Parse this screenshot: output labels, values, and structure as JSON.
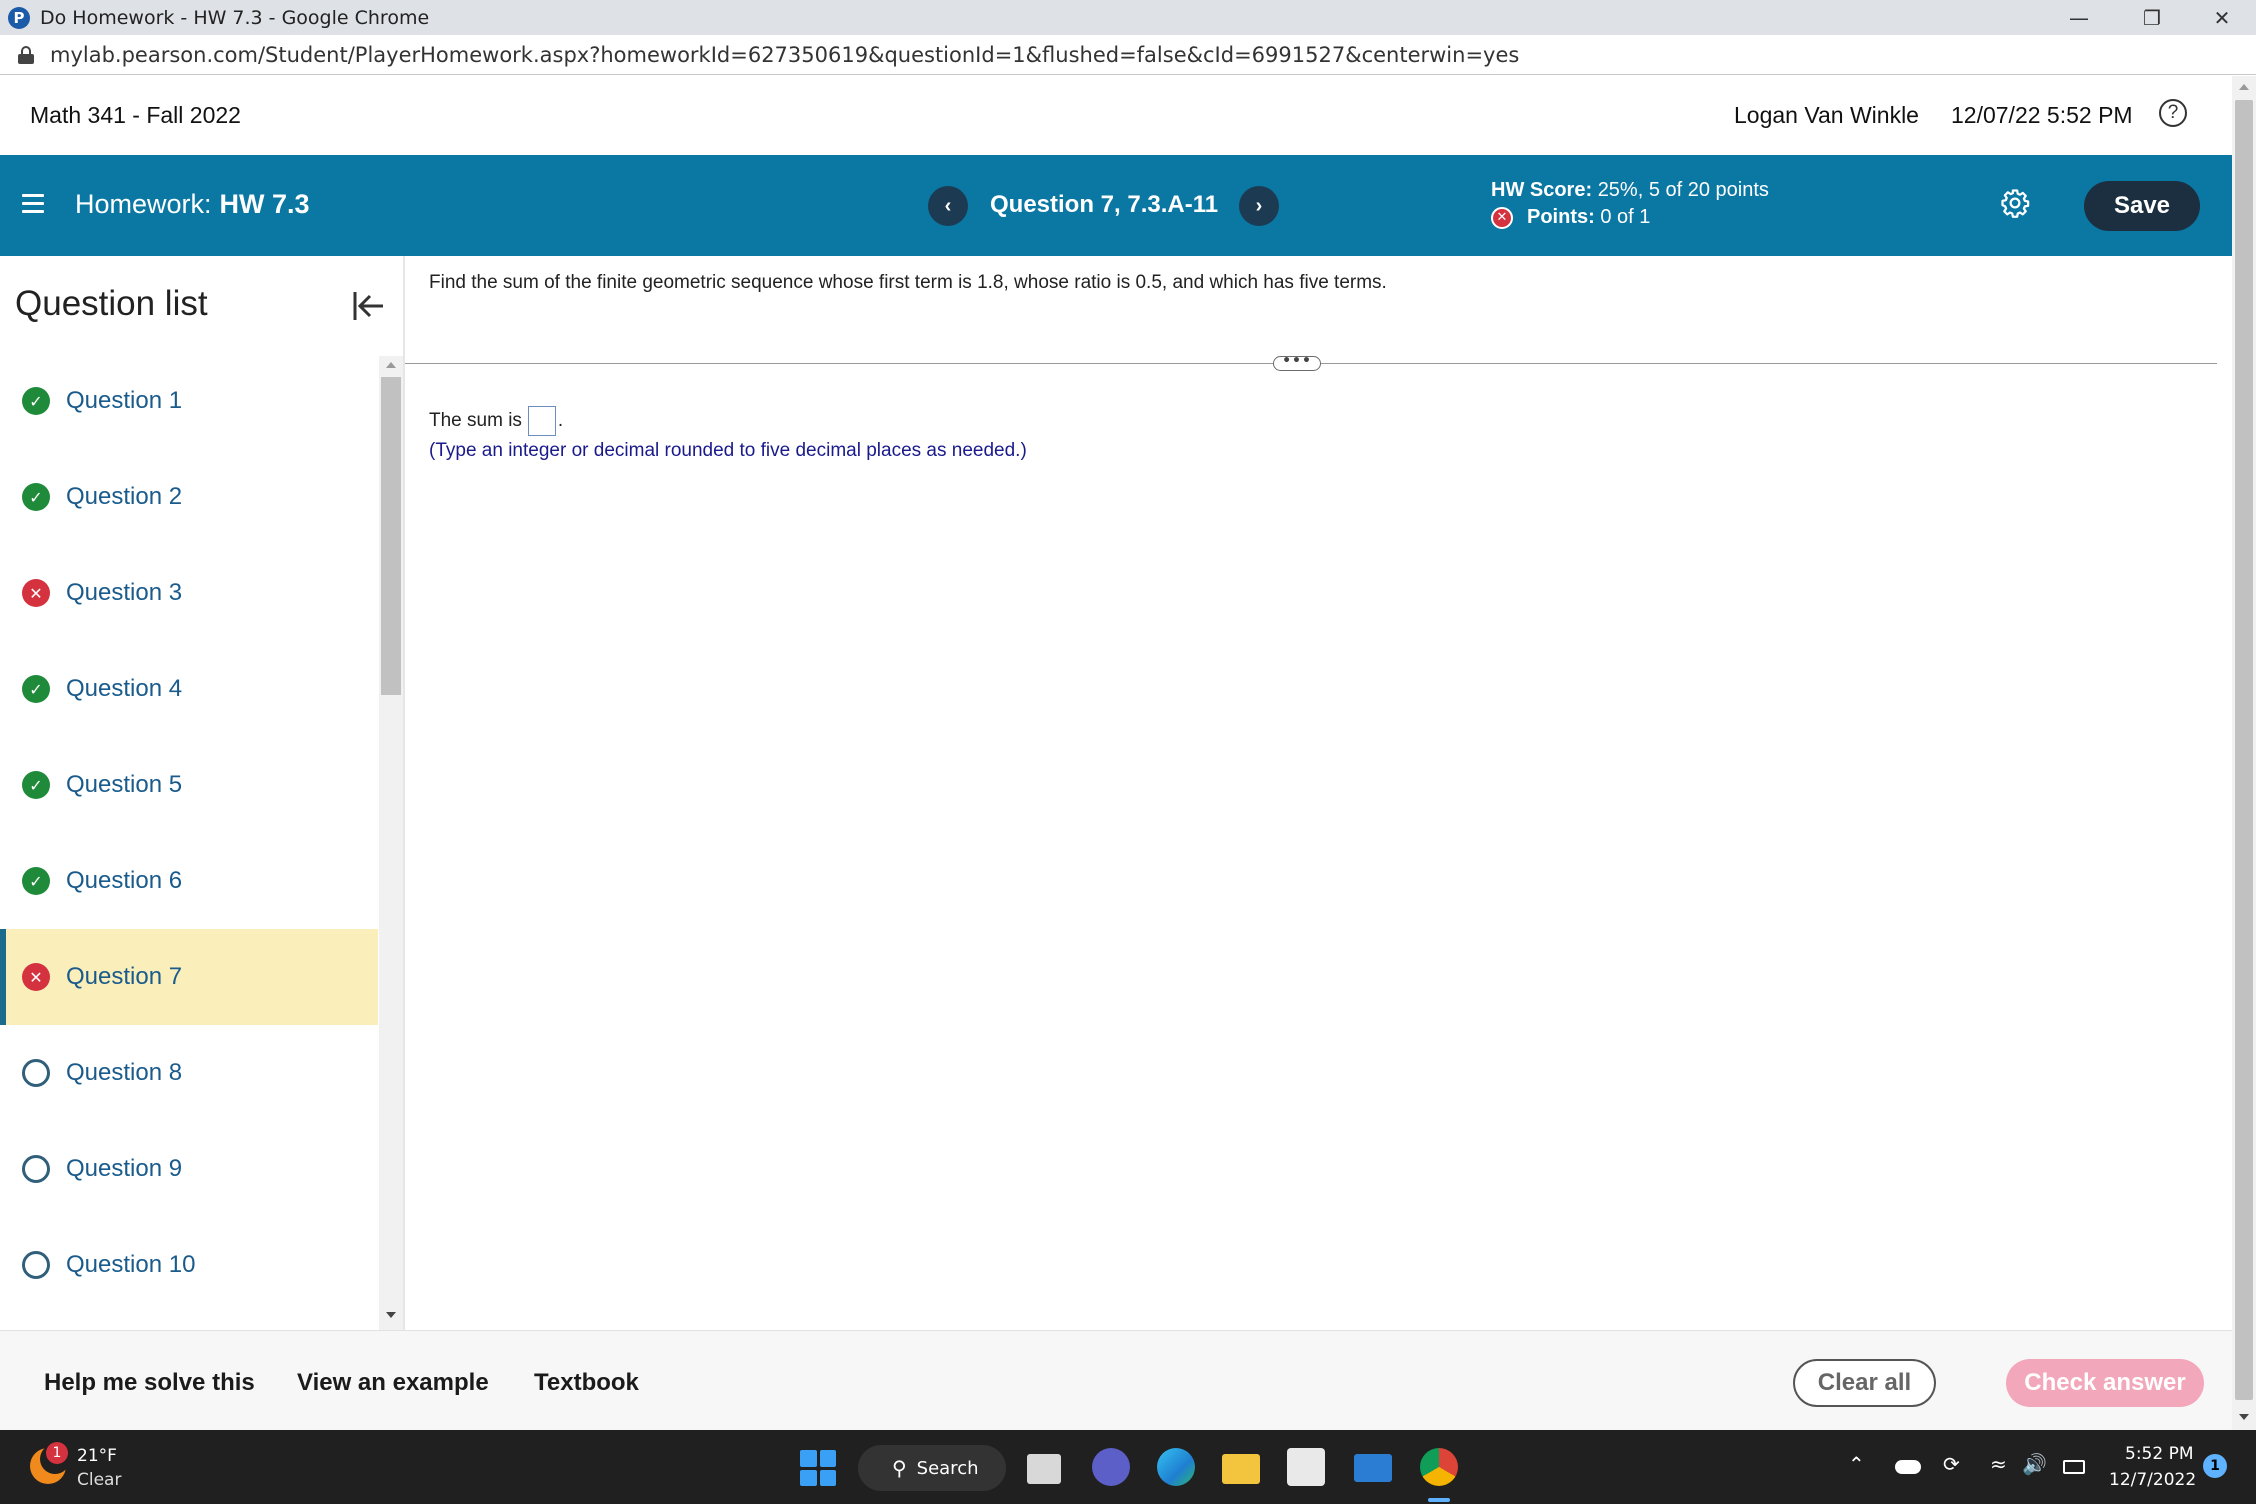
{
  "browser": {
    "window_title": "Do Homework - HW 7.3 - Google Chrome",
    "favicon_letter": "P",
    "url": "mylab.pearson.com/Student/PlayerHomework.aspx?homeworkId=627350619&questionId=1&flushed=false&cId=6991527&centerwin=yes"
  },
  "header": {
    "course": "Math 341 - Fall 2022",
    "user": "Logan Van Winkle",
    "datetime": "12/07/22 5:52 PM",
    "help": "?"
  },
  "hwbar": {
    "hw_prefix": "Homework:",
    "hw_name": "HW 7.3",
    "prev": "‹",
    "next": "›",
    "question_id": "Question 7, 7.3.A-11",
    "score_label": "HW Score:",
    "score_value": "25%, 5 of 20 points",
    "points_label": "Points:",
    "points_value": "0 of 1",
    "save": "Save"
  },
  "sidebar": {
    "title": "Question list",
    "items": [
      {
        "label": "Question 1",
        "status": "correct"
      },
      {
        "label": "Question 2",
        "status": "correct"
      },
      {
        "label": "Question 3",
        "status": "incorrect"
      },
      {
        "label": "Question 4",
        "status": "correct"
      },
      {
        "label": "Question 5",
        "status": "correct"
      },
      {
        "label": "Question 6",
        "status": "correct"
      },
      {
        "label": "Question 7",
        "status": "incorrect",
        "active": true
      },
      {
        "label": "Question 8",
        "status": "unanswered"
      },
      {
        "label": "Question 9",
        "status": "unanswered"
      },
      {
        "label": "Question 10",
        "status": "unanswered"
      }
    ]
  },
  "question": {
    "prompt": "Find the sum of the finite geometric sequence whose first term is 1.8, whose ratio is 0.5, and which has five terms.",
    "answer_prefix": "The sum is",
    "answer_value": "",
    "answer_suffix": ".",
    "hint": "(Type an integer or decimal rounded to five decimal places as needed.)",
    "divider_handle": "•••"
  },
  "actions": {
    "help": "Help me solve this",
    "example": "View an example",
    "textbook": "Textbook",
    "clear": "Clear all",
    "check": "Check answer"
  },
  "taskbar": {
    "weather_badge": "1",
    "temp": "21°F",
    "condition": "Clear",
    "search": "Search",
    "time": "5:52 PM",
    "date": "12/7/2022",
    "notifications": "1"
  },
  "colors": {
    "hw_bar": "#0b77a3",
    "save_button": "#1b2f40",
    "correct": "#1e8a3a",
    "incorrect": "#d3323e",
    "active_row": "#faeebb",
    "check_answer_disabled": "#f3a7bb"
  }
}
